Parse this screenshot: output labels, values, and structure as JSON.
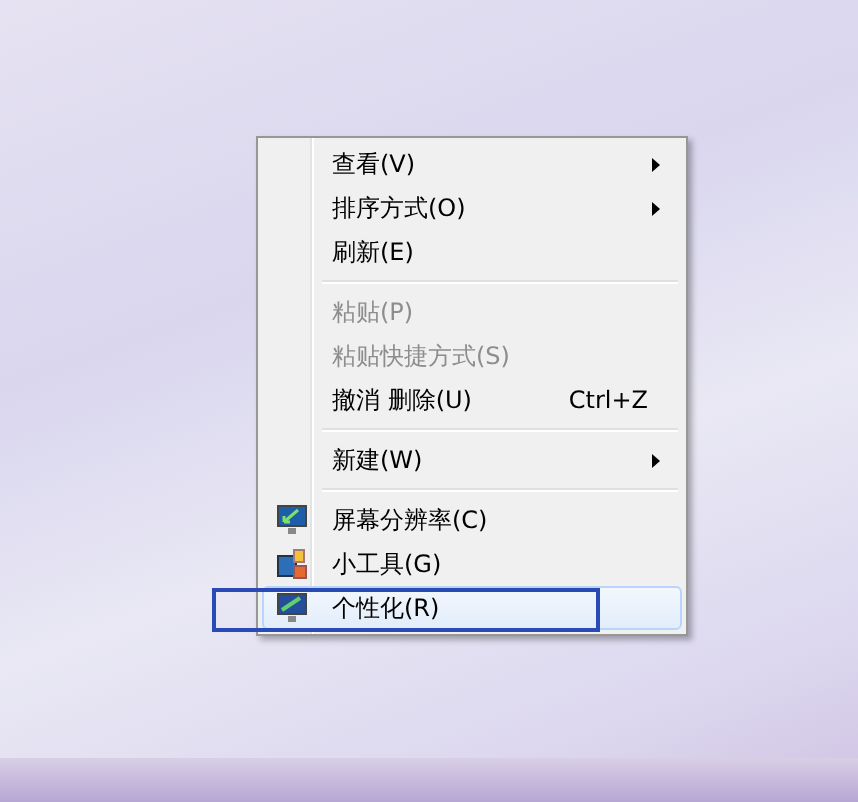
{
  "context_menu": {
    "groups": [
      {
        "items": [
          {
            "kind": "text",
            "label": "查看(V)",
            "submenu": true,
            "disabled": false,
            "selected": false
          },
          {
            "kind": "text",
            "label": "排序方式(O)",
            "submenu": true,
            "disabled": false,
            "selected": false
          },
          {
            "kind": "text",
            "label": "刷新(E)",
            "submenu": false,
            "disabled": false,
            "selected": false
          }
        ]
      },
      {
        "items": [
          {
            "kind": "text",
            "label": "粘贴(P)",
            "submenu": false,
            "disabled": true,
            "selected": false
          },
          {
            "kind": "text",
            "label": "粘贴快捷方式(S)",
            "submenu": false,
            "disabled": true,
            "selected": false
          },
          {
            "kind": "text",
            "label": "撤消 删除(U)",
            "shortcut": "Ctrl+Z",
            "submenu": false,
            "disabled": false,
            "selected": false
          }
        ]
      },
      {
        "items": [
          {
            "kind": "text",
            "label": "新建(W)",
            "submenu": true,
            "disabled": false,
            "selected": false
          }
        ]
      },
      {
        "items": [
          {
            "kind": "resolution",
            "label": "屏幕分辨率(C)",
            "submenu": false,
            "disabled": false,
            "selected": false
          },
          {
            "kind": "gadgets",
            "label": "小工具(G)",
            "submenu": false,
            "disabled": false,
            "selected": false
          },
          {
            "kind": "personalize",
            "label": "个性化(R)",
            "submenu": false,
            "disabled": false,
            "selected": true
          }
        ]
      }
    ]
  }
}
